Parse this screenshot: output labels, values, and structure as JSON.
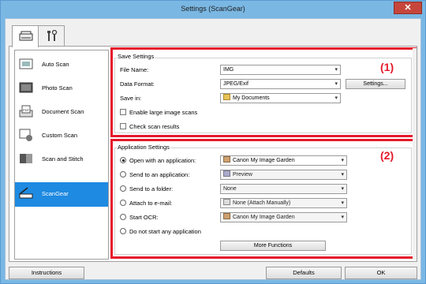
{
  "window": {
    "title": "Settings (ScanGear)",
    "close_glyph": "✕"
  },
  "tabs": [
    {
      "name": "scan-settings-tab",
      "icon": "scanner-icon",
      "active": true
    },
    {
      "name": "general-settings-tab",
      "icon": "tools-icon",
      "active": false
    }
  ],
  "modes": [
    {
      "label": "Auto Scan",
      "icon": "auto-scan-icon"
    },
    {
      "label": "Photo Scan",
      "icon": "photo-scan-icon"
    },
    {
      "label": "Document Scan",
      "icon": "document-scan-icon"
    },
    {
      "label": "Custom Scan",
      "icon": "custom-scan-icon"
    },
    {
      "label": "Scan and Stitch",
      "icon": "stitch-icon"
    },
    {
      "label": "ScanGear",
      "icon": "scangear-icon",
      "selected": true
    }
  ],
  "save_settings": {
    "title": "Save Settings",
    "file_name_label": "File Name:",
    "file_name_value": "IMG",
    "data_format_label": "Data Format:",
    "data_format_value": "JPEG/Exif",
    "settings_button": "Settings...",
    "save_in_label": "Save in:",
    "save_in_value": "My Documents",
    "enable_large_label": "Enable large image scans",
    "check_results_label": "Check scan results",
    "marker": "(1)"
  },
  "app_settings": {
    "title": "Application Settings",
    "marker": "(2)",
    "options": [
      {
        "label": "Open with an application:",
        "value": "Canon My Image Garden",
        "checked": true,
        "enabled": true
      },
      {
        "label": "Send to an application:",
        "value": "Preview",
        "checked": false,
        "enabled": false
      },
      {
        "label": "Send to a folder:",
        "value": "None",
        "checked": false,
        "enabled": false
      },
      {
        "label": "Attach to e-mail:",
        "value": "None (Attach Manually)",
        "checked": false,
        "enabled": false
      },
      {
        "label": "Start OCR:",
        "value": "Canon My Image Garden",
        "checked": false,
        "enabled": false
      },
      {
        "label": "Do not start any application",
        "checked": false
      }
    ],
    "more_functions": "More Functions"
  },
  "footer": {
    "instructions": "Instructions",
    "defaults": "Defaults",
    "ok": "OK"
  },
  "colors": {
    "highlight": "#e5192b",
    "selection": "#1e8ae1",
    "frame": "#7ab7e3"
  }
}
